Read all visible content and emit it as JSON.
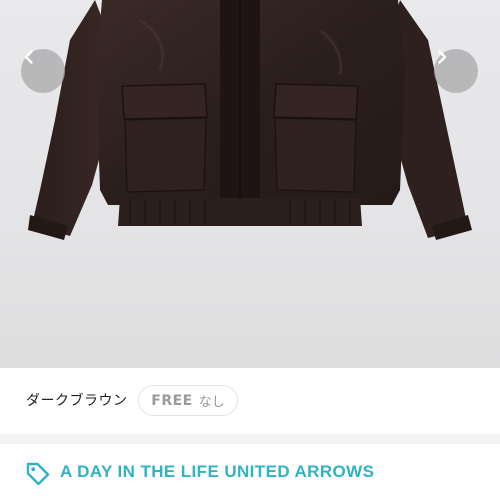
{
  "carousel": {
    "prev_icon": "chevron-left-icon",
    "next_icon": "chevron-right-icon"
  },
  "variant": {
    "color_name": "ダークブラウン",
    "size": "FREE",
    "stock_status": "なし"
  },
  "brand": {
    "icon": "tag-icon",
    "name": "A DAY IN THE LIFE UNITED ARROWS",
    "accent_color": "#2fb3c6"
  }
}
